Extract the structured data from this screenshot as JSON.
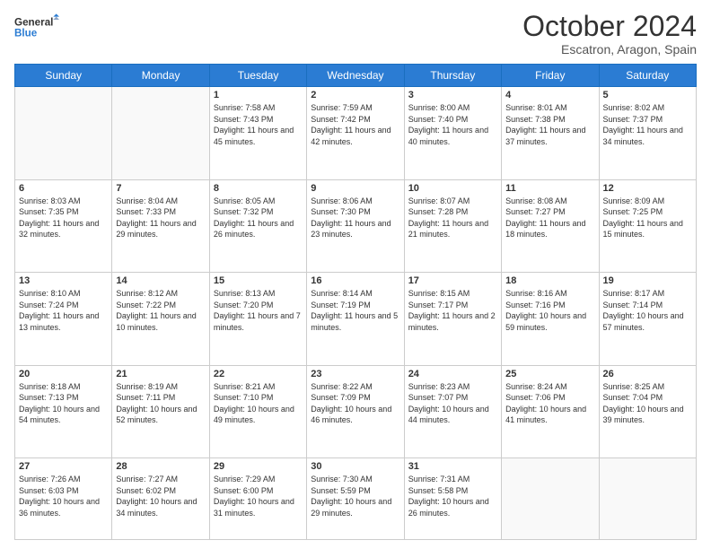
{
  "header": {
    "logo_line1": "General",
    "logo_line2": "Blue",
    "month": "October 2024",
    "location": "Escatron, Aragon, Spain"
  },
  "weekdays": [
    "Sunday",
    "Monday",
    "Tuesday",
    "Wednesday",
    "Thursday",
    "Friday",
    "Saturday"
  ],
  "weeks": [
    [
      {
        "day": "",
        "sunrise": "",
        "sunset": "",
        "daylight": ""
      },
      {
        "day": "",
        "sunrise": "",
        "sunset": "",
        "daylight": ""
      },
      {
        "day": "1",
        "sunrise": "Sunrise: 7:58 AM",
        "sunset": "Sunset: 7:43 PM",
        "daylight": "Daylight: 11 hours and 45 minutes."
      },
      {
        "day": "2",
        "sunrise": "Sunrise: 7:59 AM",
        "sunset": "Sunset: 7:42 PM",
        "daylight": "Daylight: 11 hours and 42 minutes."
      },
      {
        "day": "3",
        "sunrise": "Sunrise: 8:00 AM",
        "sunset": "Sunset: 7:40 PM",
        "daylight": "Daylight: 11 hours and 40 minutes."
      },
      {
        "day": "4",
        "sunrise": "Sunrise: 8:01 AM",
        "sunset": "Sunset: 7:38 PM",
        "daylight": "Daylight: 11 hours and 37 minutes."
      },
      {
        "day": "5",
        "sunrise": "Sunrise: 8:02 AM",
        "sunset": "Sunset: 7:37 PM",
        "daylight": "Daylight: 11 hours and 34 minutes."
      }
    ],
    [
      {
        "day": "6",
        "sunrise": "Sunrise: 8:03 AM",
        "sunset": "Sunset: 7:35 PM",
        "daylight": "Daylight: 11 hours and 32 minutes."
      },
      {
        "day": "7",
        "sunrise": "Sunrise: 8:04 AM",
        "sunset": "Sunset: 7:33 PM",
        "daylight": "Daylight: 11 hours and 29 minutes."
      },
      {
        "day": "8",
        "sunrise": "Sunrise: 8:05 AM",
        "sunset": "Sunset: 7:32 PM",
        "daylight": "Daylight: 11 hours and 26 minutes."
      },
      {
        "day": "9",
        "sunrise": "Sunrise: 8:06 AM",
        "sunset": "Sunset: 7:30 PM",
        "daylight": "Daylight: 11 hours and 23 minutes."
      },
      {
        "day": "10",
        "sunrise": "Sunrise: 8:07 AM",
        "sunset": "Sunset: 7:28 PM",
        "daylight": "Daylight: 11 hours and 21 minutes."
      },
      {
        "day": "11",
        "sunrise": "Sunrise: 8:08 AM",
        "sunset": "Sunset: 7:27 PM",
        "daylight": "Daylight: 11 hours and 18 minutes."
      },
      {
        "day": "12",
        "sunrise": "Sunrise: 8:09 AM",
        "sunset": "Sunset: 7:25 PM",
        "daylight": "Daylight: 11 hours and 15 minutes."
      }
    ],
    [
      {
        "day": "13",
        "sunrise": "Sunrise: 8:10 AM",
        "sunset": "Sunset: 7:24 PM",
        "daylight": "Daylight: 11 hours and 13 minutes."
      },
      {
        "day": "14",
        "sunrise": "Sunrise: 8:12 AM",
        "sunset": "Sunset: 7:22 PM",
        "daylight": "Daylight: 11 hours and 10 minutes."
      },
      {
        "day": "15",
        "sunrise": "Sunrise: 8:13 AM",
        "sunset": "Sunset: 7:20 PM",
        "daylight": "Daylight: 11 hours and 7 minutes."
      },
      {
        "day": "16",
        "sunrise": "Sunrise: 8:14 AM",
        "sunset": "Sunset: 7:19 PM",
        "daylight": "Daylight: 11 hours and 5 minutes."
      },
      {
        "day": "17",
        "sunrise": "Sunrise: 8:15 AM",
        "sunset": "Sunset: 7:17 PM",
        "daylight": "Daylight: 11 hours and 2 minutes."
      },
      {
        "day": "18",
        "sunrise": "Sunrise: 8:16 AM",
        "sunset": "Sunset: 7:16 PM",
        "daylight": "Daylight: 10 hours and 59 minutes."
      },
      {
        "day": "19",
        "sunrise": "Sunrise: 8:17 AM",
        "sunset": "Sunset: 7:14 PM",
        "daylight": "Daylight: 10 hours and 57 minutes."
      }
    ],
    [
      {
        "day": "20",
        "sunrise": "Sunrise: 8:18 AM",
        "sunset": "Sunset: 7:13 PM",
        "daylight": "Daylight: 10 hours and 54 minutes."
      },
      {
        "day": "21",
        "sunrise": "Sunrise: 8:19 AM",
        "sunset": "Sunset: 7:11 PM",
        "daylight": "Daylight: 10 hours and 52 minutes."
      },
      {
        "day": "22",
        "sunrise": "Sunrise: 8:21 AM",
        "sunset": "Sunset: 7:10 PM",
        "daylight": "Daylight: 10 hours and 49 minutes."
      },
      {
        "day": "23",
        "sunrise": "Sunrise: 8:22 AM",
        "sunset": "Sunset: 7:09 PM",
        "daylight": "Daylight: 10 hours and 46 minutes."
      },
      {
        "day": "24",
        "sunrise": "Sunrise: 8:23 AM",
        "sunset": "Sunset: 7:07 PM",
        "daylight": "Daylight: 10 hours and 44 minutes."
      },
      {
        "day": "25",
        "sunrise": "Sunrise: 8:24 AM",
        "sunset": "Sunset: 7:06 PM",
        "daylight": "Daylight: 10 hours and 41 minutes."
      },
      {
        "day": "26",
        "sunrise": "Sunrise: 8:25 AM",
        "sunset": "Sunset: 7:04 PM",
        "daylight": "Daylight: 10 hours and 39 minutes."
      }
    ],
    [
      {
        "day": "27",
        "sunrise": "Sunrise: 7:26 AM",
        "sunset": "Sunset: 6:03 PM",
        "daylight": "Daylight: 10 hours and 36 minutes."
      },
      {
        "day": "28",
        "sunrise": "Sunrise: 7:27 AM",
        "sunset": "Sunset: 6:02 PM",
        "daylight": "Daylight: 10 hours and 34 minutes."
      },
      {
        "day": "29",
        "sunrise": "Sunrise: 7:29 AM",
        "sunset": "Sunset: 6:00 PM",
        "daylight": "Daylight: 10 hours and 31 minutes."
      },
      {
        "day": "30",
        "sunrise": "Sunrise: 7:30 AM",
        "sunset": "Sunset: 5:59 PM",
        "daylight": "Daylight: 10 hours and 29 minutes."
      },
      {
        "day": "31",
        "sunrise": "Sunrise: 7:31 AM",
        "sunset": "Sunset: 5:58 PM",
        "daylight": "Daylight: 10 hours and 26 minutes."
      },
      {
        "day": "",
        "sunrise": "",
        "sunset": "",
        "daylight": ""
      },
      {
        "day": "",
        "sunrise": "",
        "sunset": "",
        "daylight": ""
      }
    ]
  ]
}
